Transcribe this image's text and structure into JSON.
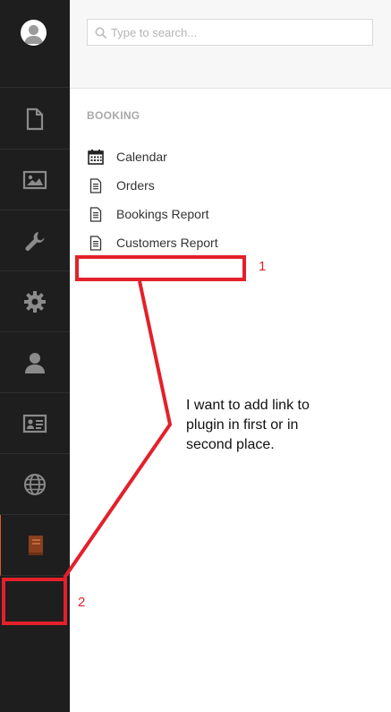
{
  "sidebar": {
    "avatar_icon": "user-avatar-icon",
    "items": [
      {
        "icon": "file-icon"
      },
      {
        "icon": "image-icon"
      },
      {
        "icon": "wrench-icon"
      },
      {
        "icon": "gear-icon"
      },
      {
        "icon": "user-icon"
      },
      {
        "icon": "id-card-icon"
      },
      {
        "icon": "globe-icon"
      },
      {
        "icon": "book-icon",
        "active": true,
        "accent": "#d35a2a"
      }
    ]
  },
  "search": {
    "placeholder": "Type to search..."
  },
  "menu": {
    "section_title": "BOOKING",
    "items": [
      {
        "label": "Calendar",
        "icon": "calendar-icon"
      },
      {
        "label": "Orders",
        "icon": "document-icon"
      },
      {
        "label": "Bookings Report",
        "icon": "document-icon"
      },
      {
        "label": "Customers Report",
        "icon": "document-icon"
      }
    ]
  },
  "annotations": {
    "color": "#e4202a",
    "marker_1": "1",
    "marker_2": "2",
    "note": "I want to add link to plugin in first or in second place."
  }
}
